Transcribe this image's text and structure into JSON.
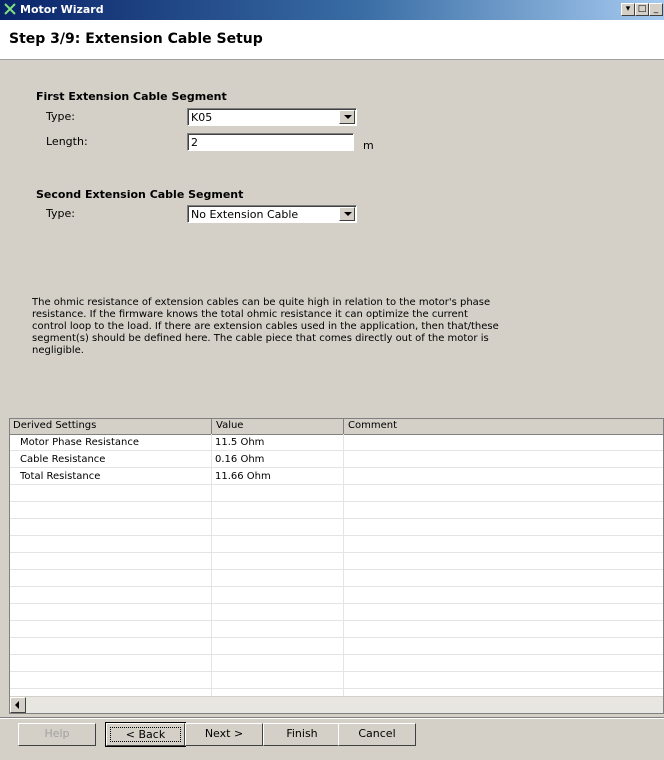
{
  "window": {
    "title": "Motor Wizard",
    "icon": "motor-wizard-icon"
  },
  "header": {
    "step_title": "Step 3/9: Extension Cable Setup"
  },
  "first_segment": {
    "heading": "First Extension Cable Segment",
    "type_label": "Type:",
    "type_value": "K05",
    "length_label": "Length:",
    "length_value": "2",
    "length_unit": "m"
  },
  "second_segment": {
    "heading": "Second Extension Cable Segment",
    "type_label": "Type:",
    "type_value": "No Extension Cable"
  },
  "description": "The ohmic resistance of extension cables can be quite high in relation to the motor's phase resistance. If the firmware knows the total ohmic resistance it can optimize the current control loop to the load. If there are extension cables used in the application, then that/these segment(s) should be defined here. The cable piece that comes directly out of the motor is negligible.",
  "grid": {
    "columns": [
      "Derived Settings",
      "Value",
      "Comment"
    ],
    "rows": [
      {
        "setting": "Motor Phase Resistance",
        "value": "11.5 Ohm",
        "comment": ""
      },
      {
        "setting": "Cable Resistance",
        "value": "0.16 Ohm",
        "comment": ""
      },
      {
        "setting": "Total Resistance",
        "value": "11.66 Ohm",
        "comment": ""
      }
    ]
  },
  "buttons": {
    "help": "Help",
    "back": "< Back",
    "next": "Next >",
    "finish": "Finish",
    "cancel": "Cancel"
  }
}
